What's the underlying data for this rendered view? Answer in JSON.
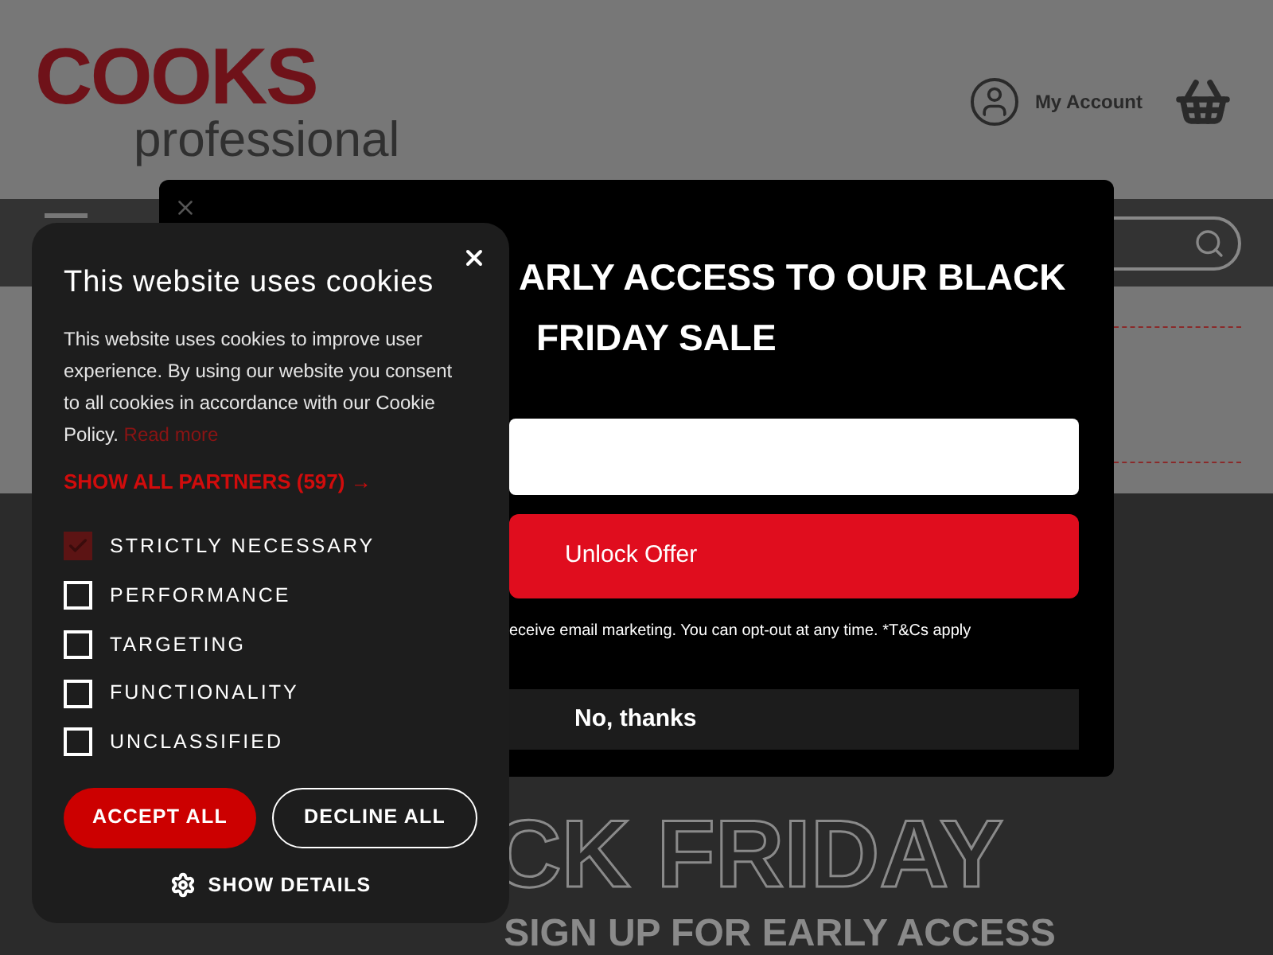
{
  "header": {
    "logo": {
      "brand": "COOKS",
      "tagline": "professional"
    },
    "account_label": "My Account"
  },
  "hero": {
    "line_1": "CK FRIDAY",
    "line_2": "SIGN UP FOR EARLY ACCESS"
  },
  "signup_modal": {
    "title_lines": [
      "ARLY ACCESS TO OUR BLACK",
      "FRIDAY SALE"
    ],
    "submit_button": "Unlock Offer",
    "disclaimer": "eceive email marketing. You can opt-out at any time. *T&Cs apply",
    "decline_button": "No, thanks"
  },
  "cookie_banner": {
    "title": "This website uses cookies",
    "body": "This website uses cookies to improve user experience. By using our website you consent to all cookies in accordance with our Cookie Policy.",
    "read_more": "Read more",
    "partners_link": "SHOW ALL PARTNERS (597) →",
    "categories": [
      {
        "label": "STRICTLY NECESSARY",
        "checked": true
      },
      {
        "label": "PERFORMANCE",
        "checked": false
      },
      {
        "label": "TARGETING",
        "checked": false
      },
      {
        "label": "FUNCTIONALITY",
        "checked": false
      },
      {
        "label": "UNCLASSIFIED",
        "checked": false
      }
    ],
    "accept_button": "ACCEPT ALL",
    "decline_button": "DECLINE ALL",
    "details_button": "SHOW DETAILS"
  }
}
